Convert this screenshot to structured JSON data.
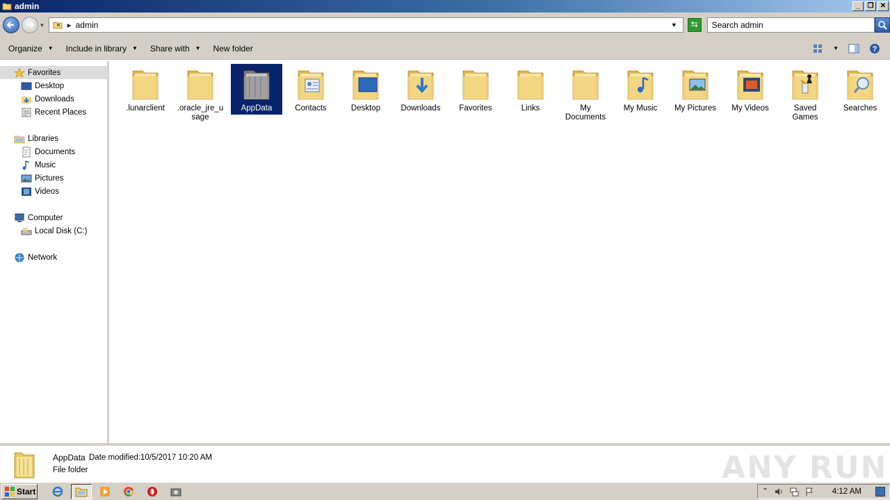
{
  "window": {
    "title": "admin",
    "buttons": {
      "minimize": "_",
      "maximize": "❐",
      "close": "✕"
    }
  },
  "address_bar": {
    "path": [
      "admin"
    ],
    "search_placeholder": "Search admin"
  },
  "toolbar": {
    "organize": "Organize",
    "include_in_library": "Include in library",
    "share_with": "Share with",
    "new_folder": "New folder"
  },
  "nav_pane": {
    "favorites": {
      "label": "Favorites",
      "items": [
        "Desktop",
        "Downloads",
        "Recent Places"
      ]
    },
    "libraries": {
      "label": "Libraries",
      "items": [
        "Documents",
        "Music",
        "Pictures",
        "Videos"
      ]
    },
    "computer": {
      "label": "Computer",
      "items": [
        "Local Disk (C:)"
      ]
    },
    "network": {
      "label": "Network"
    }
  },
  "files": [
    {
      "name": ".lunarclient",
      "icon": "folder-icon"
    },
    {
      "name": ".oracle_jre_usage",
      "icon": "folder-icon"
    },
    {
      "name": "AppData",
      "icon": "folder-hidden-icon",
      "selected": true
    },
    {
      "name": "Contacts",
      "icon": "contacts-folder-icon"
    },
    {
      "name": "Desktop",
      "icon": "desktop-folder-icon"
    },
    {
      "name": "Downloads",
      "icon": "downloads-folder-icon"
    },
    {
      "name": "Favorites",
      "icon": "favorites-folder-icon"
    },
    {
      "name": "Links",
      "icon": "links-folder-icon"
    },
    {
      "name": "My Documents",
      "icon": "documents-folder-icon"
    },
    {
      "name": "My Music",
      "icon": "music-folder-icon"
    },
    {
      "name": "My Pictures",
      "icon": "pictures-folder-icon"
    },
    {
      "name": "My Videos",
      "icon": "videos-folder-icon"
    },
    {
      "name": "Saved Games",
      "icon": "games-folder-icon"
    },
    {
      "name": "Searches",
      "icon": "searches-folder-icon"
    }
  ],
  "details": {
    "name": "AppData",
    "modified_label": "Date modified:",
    "modified_value": "10/5/2017 10:20 AM",
    "type": "File folder",
    "watermark": "ANY RUN"
  },
  "taskbar": {
    "start": "Start",
    "clock": "4:12 AM"
  },
  "colors": {
    "selection": "#0a246a",
    "chrome": "#d4d0c8",
    "folder": "#f2d27a"
  }
}
